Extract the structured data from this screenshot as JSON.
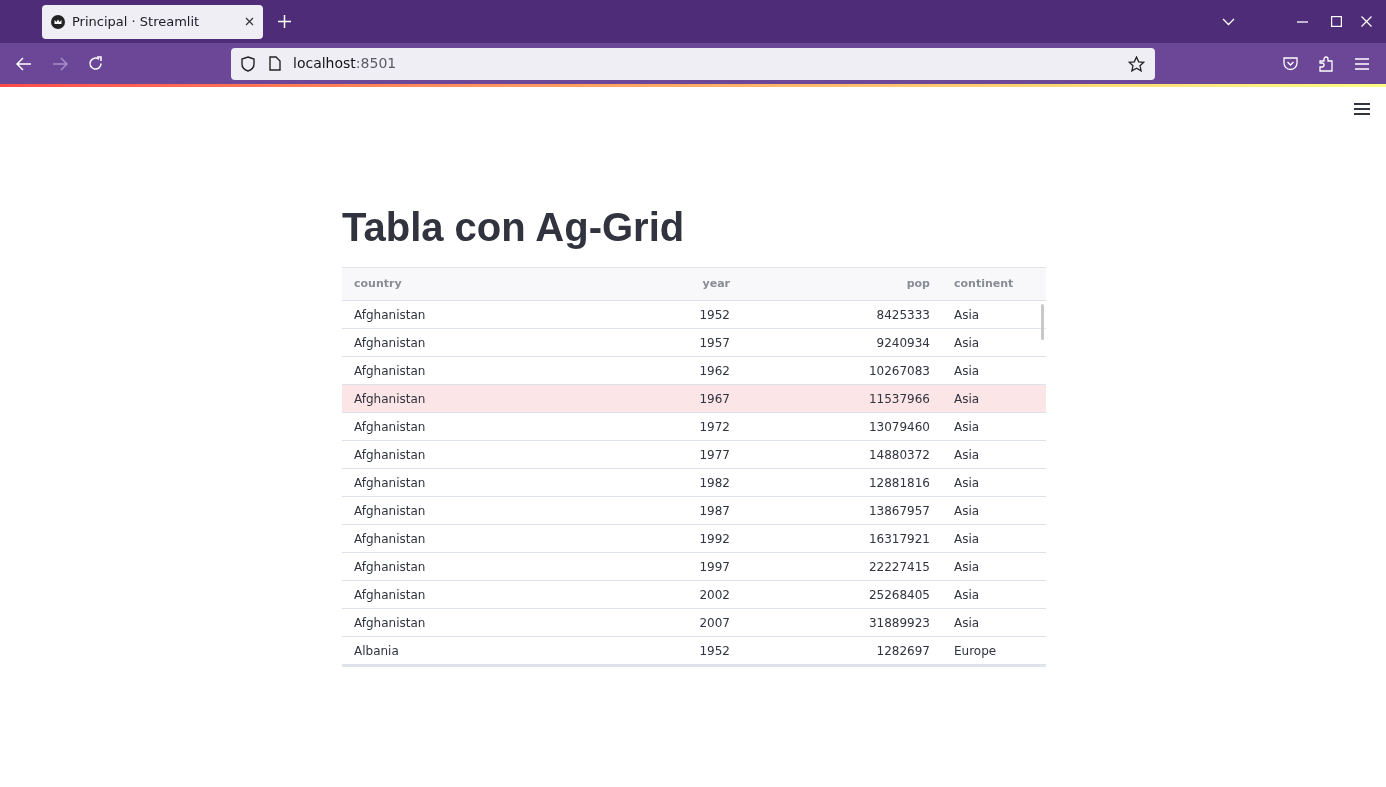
{
  "browser": {
    "tab_title": "Principal · Streamlit",
    "url_host": "localhost",
    "url_port": ":8501"
  },
  "page": {
    "title": "Tabla con Ag-Grid"
  },
  "table": {
    "columns": [
      {
        "label": "country",
        "kind": "text"
      },
      {
        "label": "year",
        "kind": "number"
      },
      {
        "label": "pop",
        "kind": "number"
      },
      {
        "label": "continent",
        "kind": "text"
      }
    ],
    "rows": [
      {
        "cells": [
          "Afghanistan",
          "1952",
          "8425333",
          "Asia"
        ],
        "selected": false
      },
      {
        "cells": [
          "Afghanistan",
          "1957",
          "9240934",
          "Asia"
        ],
        "selected": false
      },
      {
        "cells": [
          "Afghanistan",
          "1962",
          "10267083",
          "Asia"
        ],
        "selected": false
      },
      {
        "cells": [
          "Afghanistan",
          "1967",
          "11537966",
          "Asia"
        ],
        "selected": true
      },
      {
        "cells": [
          "Afghanistan",
          "1972",
          "13079460",
          "Asia"
        ],
        "selected": false
      },
      {
        "cells": [
          "Afghanistan",
          "1977",
          "14880372",
          "Asia"
        ],
        "selected": false
      },
      {
        "cells": [
          "Afghanistan",
          "1982",
          "12881816",
          "Asia"
        ],
        "selected": false
      },
      {
        "cells": [
          "Afghanistan",
          "1987",
          "13867957",
          "Asia"
        ],
        "selected": false
      },
      {
        "cells": [
          "Afghanistan",
          "1992",
          "16317921",
          "Asia"
        ],
        "selected": false
      },
      {
        "cells": [
          "Afghanistan",
          "1997",
          "22227415",
          "Asia"
        ],
        "selected": false
      },
      {
        "cells": [
          "Afghanistan",
          "2002",
          "25268405",
          "Asia"
        ],
        "selected": false
      },
      {
        "cells": [
          "Afghanistan",
          "2007",
          "31889923",
          "Asia"
        ],
        "selected": false
      },
      {
        "cells": [
          "Albania",
          "1952",
          "1282697",
          "Europe"
        ],
        "selected": false
      }
    ]
  }
}
